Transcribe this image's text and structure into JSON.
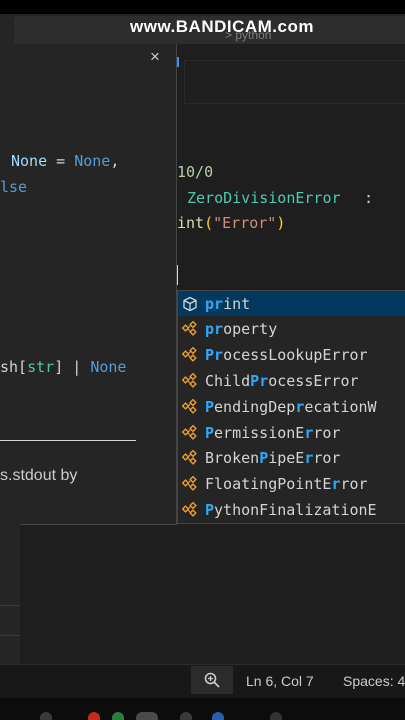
{
  "watermark": "www.BANDICAM.com",
  "breadcrumb": "> python",
  "hover": {
    "close_glyph": "×",
    "line1": "None = None,",
    "line2": "lse",
    "line3_a": "sh[",
    "line3_b": "str",
    "line3_c": "] | ",
    "line3_d": "None",
    "doc": "s.stdout by"
  },
  "code": {
    "line1": "10/0",
    "line2_type": "ZeroDivisionError",
    "line2_colon": ":",
    "line3_fn": "int",
    "line3_open": "(",
    "line3_str": "\"Error\"",
    "line3_close": ")"
  },
  "suggestions": [
    {
      "hl": "pr",
      "rest": "int",
      "icon": "cube-icon",
      "selected": true
    },
    {
      "hl": "pr",
      "rest": "operty",
      "icon": "class-icon"
    },
    {
      "parts": [
        "",
        "P",
        "",
        "r",
        "ocessLookupError"
      ],
      "icon": "class-icon"
    },
    {
      "parts": [
        "Child",
        "P",
        "",
        "r",
        "ocessError"
      ],
      "icon": "class-icon"
    },
    {
      "parts": [
        "",
        "P",
        "endingDep",
        "r",
        "ecationW"
      ],
      "icon": "class-icon"
    },
    {
      "parts": [
        "",
        "P",
        "ermissionE",
        "r",
        "ror"
      ],
      "icon": "class-icon"
    },
    {
      "parts": [
        "Broken",
        "P",
        "ipeE",
        "r",
        "ror"
      ],
      "icon": "class-icon"
    },
    {
      "parts": [
        "FloatingPointE",
        "",
        "",
        "r",
        "ror"
      ],
      "icon": "class-icon",
      "fp": true
    },
    {
      "parts": [
        "",
        "P",
        "ythonFinalizationE",
        "",
        ""
      ],
      "icon": "class-icon"
    }
  ],
  "statusbar": {
    "position": "Ln 6, Col 7",
    "spaces": "Spaces: 4"
  },
  "colors": {
    "accent": "#2aaaff",
    "selected_bg": "#04395e",
    "class_icon": "#ee9d28"
  }
}
